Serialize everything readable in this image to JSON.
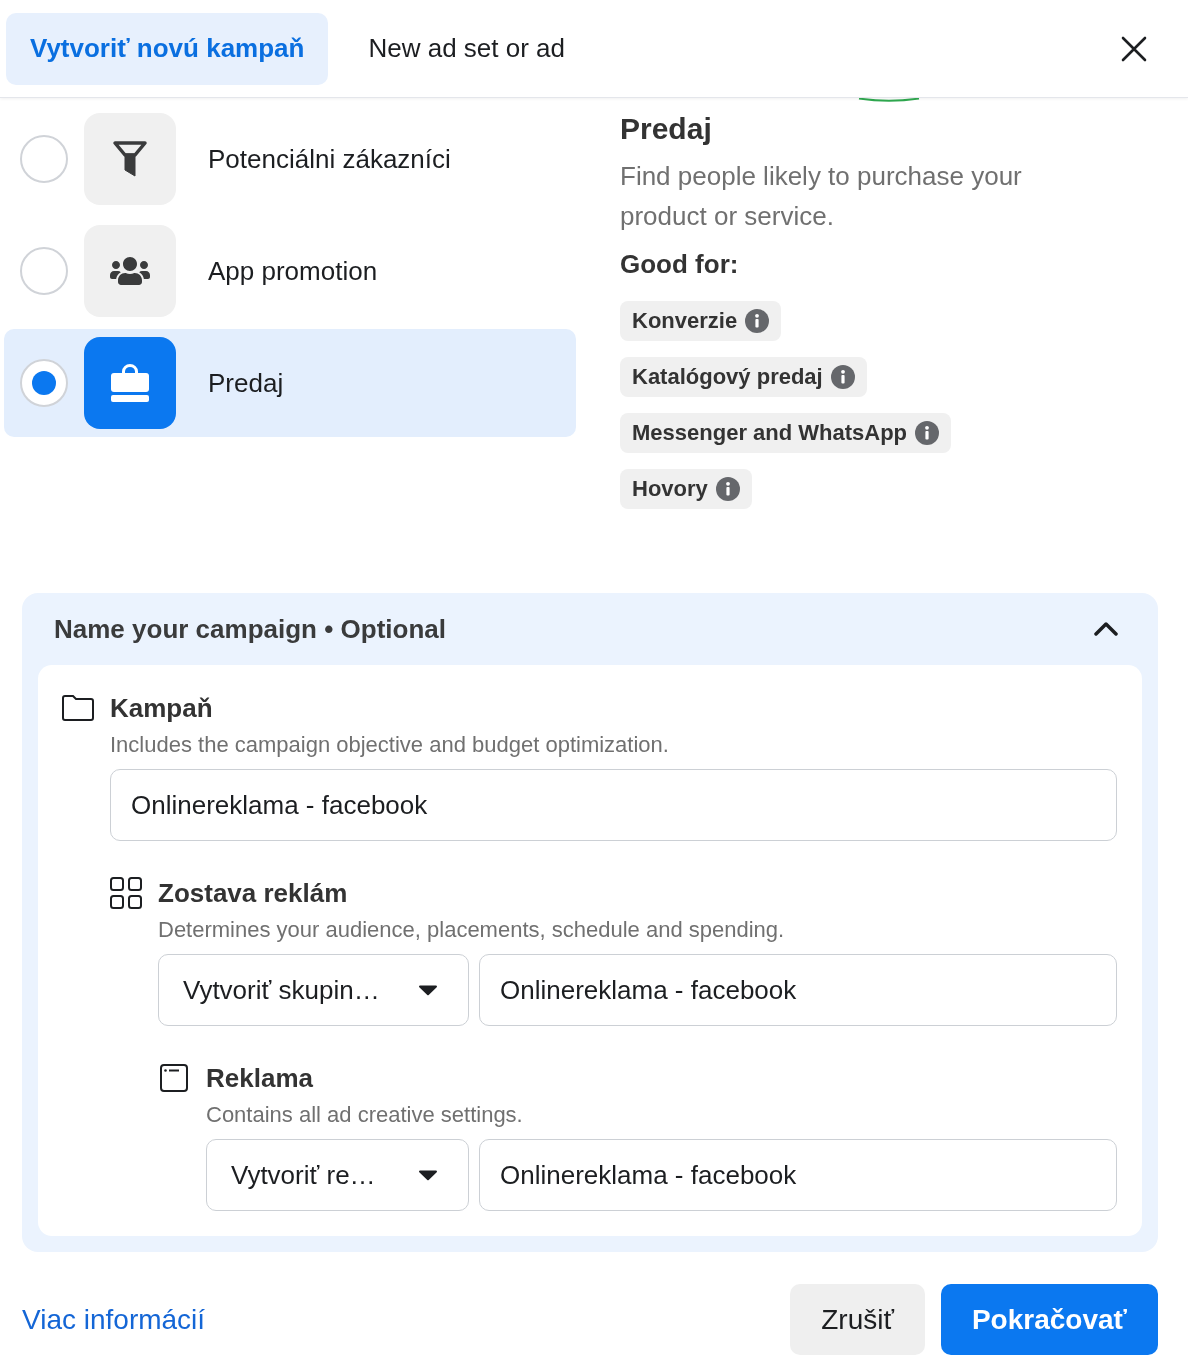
{
  "header": {
    "tabs": [
      {
        "label": "Vytvoriť novú kampaň",
        "selected": true
      },
      {
        "label": "New ad set or ad",
        "selected": false
      }
    ]
  },
  "objectives": [
    {
      "label": "Potenciálni zákazníci",
      "selected": false
    },
    {
      "label": "App promotion",
      "selected": false
    },
    {
      "label": "Predaj",
      "selected": true
    }
  ],
  "details": {
    "title": "Predaj",
    "description": "Find people likely to purchase your product or service.",
    "good_for_label": "Good for:",
    "good_for": [
      "Konverzie",
      "Katalógový predaj",
      "Messenger and WhatsApp",
      "Hovory"
    ]
  },
  "name_section": {
    "title": "Name your campaign • Optional",
    "expanded": true,
    "levels": [
      {
        "title": "Kampaň",
        "description": "Includes the campaign objective and budget optimization.",
        "value": "Onlinereklama - facebook",
        "children": [
          {
            "title": "Zostava reklám",
            "description": "Determines your audience, placements, schedule and spending.",
            "select": "Vytvoriť skupin…",
            "value": "Onlinereklama - facebook",
            "children": [
              {
                "title": "Reklama",
                "description": "Contains all ad creative settings.",
                "select": "Vytvoriť re…",
                "value": "Onlinereklama - facebook"
              }
            ]
          }
        ]
      }
    ]
  },
  "footer": {
    "link": "Viac informácií",
    "buttons": [
      {
        "label": "Zrušiť",
        "kind": "secondary"
      },
      {
        "label": "Pokračovať",
        "kind": "primary"
      }
    ]
  }
}
